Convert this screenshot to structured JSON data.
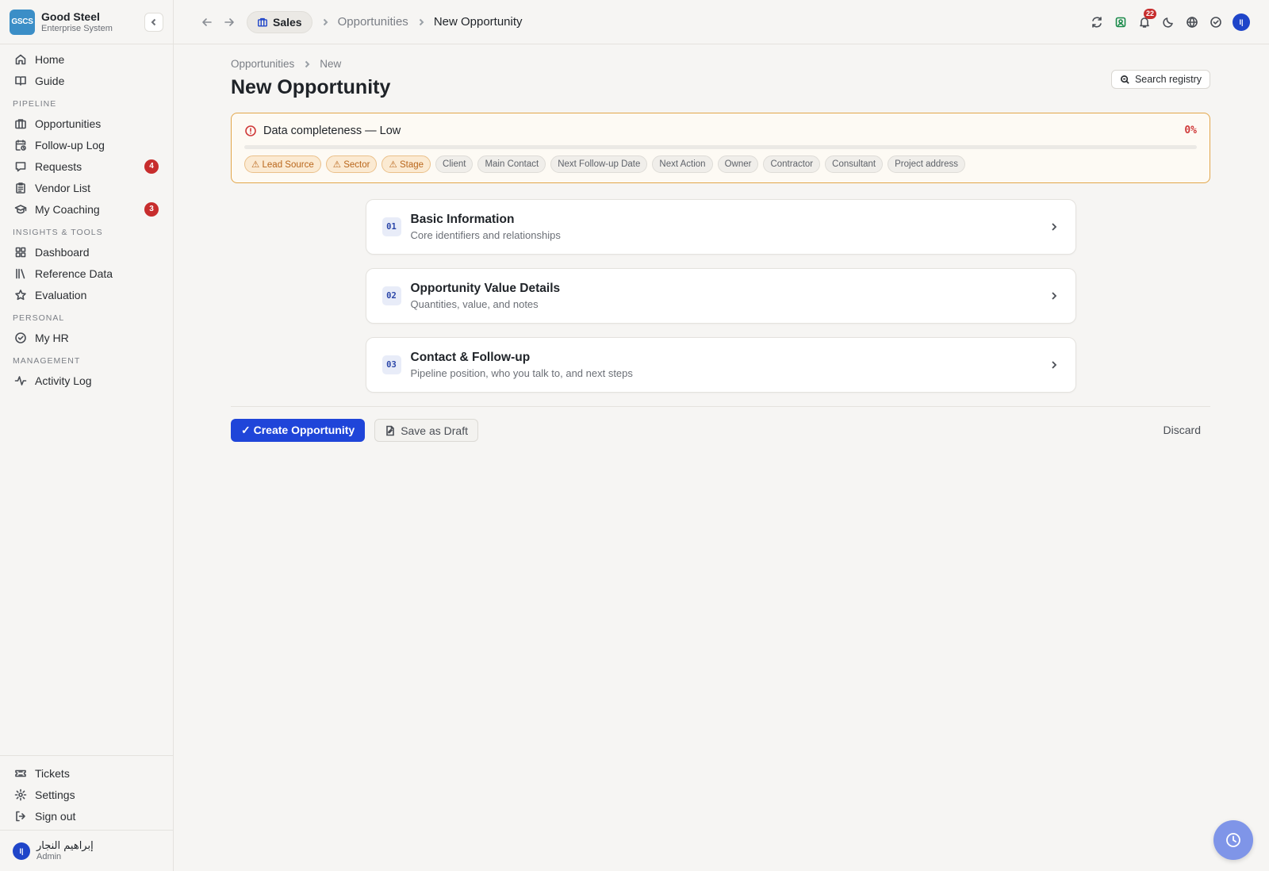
{
  "brand": {
    "logo_text": "GSCS",
    "name": "Good Steel",
    "subtitle": "Enterprise System"
  },
  "sidebar": {
    "top_items": [
      {
        "label": "Home",
        "icon": "home-icon"
      },
      {
        "label": "Guide",
        "icon": "book-icon"
      }
    ],
    "sections": [
      {
        "title": "PIPELINE",
        "items": [
          {
            "label": "Opportunities",
            "icon": "briefcase-icon"
          },
          {
            "label": "Follow-up Log",
            "icon": "calendar-clock-icon"
          },
          {
            "label": "Requests",
            "icon": "message-icon",
            "badge": "4"
          },
          {
            "label": "Vendor List",
            "icon": "clipboard-icon"
          },
          {
            "label": "My Coaching",
            "icon": "graduation-cap-icon",
            "badge": "3"
          }
        ]
      },
      {
        "title": "INSIGHTS & TOOLS",
        "items": [
          {
            "label": "Dashboard",
            "icon": "dashboard-icon"
          },
          {
            "label": "Reference Data",
            "icon": "library-icon"
          },
          {
            "label": "Evaluation",
            "icon": "star-icon"
          }
        ]
      },
      {
        "title": "PERSONAL",
        "items": [
          {
            "label": "My HR",
            "icon": "check-circle-icon"
          }
        ]
      },
      {
        "title": "MANAGEMENT",
        "items": [
          {
            "label": "Activity Log",
            "icon": "activity-icon"
          }
        ]
      }
    ],
    "bottom_items": [
      {
        "label": "Tickets",
        "icon": "ticket-icon"
      },
      {
        "label": "Settings",
        "icon": "gear-icon"
      },
      {
        "label": "Sign out",
        "icon": "sign-out-icon"
      }
    ],
    "user": {
      "initials": "I|",
      "name": "إبراهيم النجار",
      "role": "Admin"
    }
  },
  "topbar": {
    "module": "Sales",
    "crumbs": [
      "Opportunities",
      "New Opportunity"
    ],
    "notification_count": "22",
    "avatar_initials": "I|"
  },
  "page": {
    "crumbs": [
      "Opportunities",
      "New"
    ],
    "title": "New Opportunity",
    "search_label": "Search registry",
    "completeness": {
      "label": "Data completeness — Low",
      "percent_label": "0%",
      "percent": 0,
      "chips": [
        {
          "label": "⚠ Lead Source",
          "warn": true
        },
        {
          "label": "⚠ Sector",
          "warn": true
        },
        {
          "label": "⚠ Stage",
          "warn": true
        },
        {
          "label": "Client",
          "warn": false
        },
        {
          "label": "Main Contact",
          "warn": false
        },
        {
          "label": "Next Follow-up Date",
          "warn": false
        },
        {
          "label": "Next Action",
          "warn": false
        },
        {
          "label": "Owner",
          "warn": false
        },
        {
          "label": "Contractor",
          "warn": false
        },
        {
          "label": "Consultant",
          "warn": false
        },
        {
          "label": "Project address",
          "warn": false
        }
      ]
    },
    "sections": [
      {
        "num": "01",
        "title": "Basic Information",
        "subtitle": "Core identifiers and relationships"
      },
      {
        "num": "02",
        "title": "Opportunity Value Details",
        "subtitle": "Quantities, value, and notes"
      },
      {
        "num": "03",
        "title": "Contact & Follow-up",
        "subtitle": "Pipeline position, who you talk to, and next steps"
      }
    ],
    "actions": {
      "create": "✓ Create Opportunity",
      "draft": "Save as Draft",
      "discard": "Discard"
    }
  },
  "colors": {
    "accent": "#1f45d9",
    "warning": "#e2a64a",
    "danger": "#d03a3a",
    "badge": "#c72d2d"
  }
}
